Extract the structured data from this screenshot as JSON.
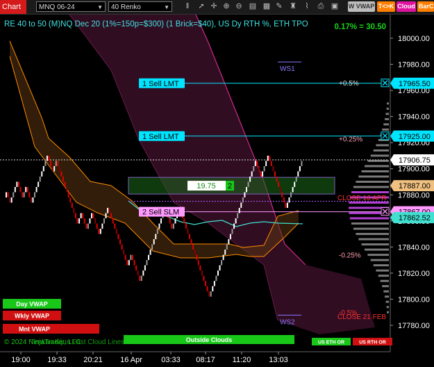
{
  "toolbar": {
    "chart_label": "Chart",
    "instrument": "MNQ 06-24",
    "bar_type": "40 Renko",
    "icons": [
      "bars-icon",
      "pointer-icon",
      "crosshair-icon",
      "zoom-in-icon",
      "zoom-out-icon",
      "properties-icon",
      "data-box-icon",
      "draw-icon",
      "strategy-icon",
      "indicators-icon",
      "templates-icon",
      "snapshot-icon"
    ],
    "buttons": [
      {
        "label": "W VWAP",
        "color": "#bdbdbd"
      },
      {
        "label": "T<>K",
        "color": "#ff7f00"
      },
      {
        "label": "Cloud",
        "color": "#e0119f"
      },
      {
        "label": "BarCo",
        "color": "#ff7f00"
      }
    ]
  },
  "chart_data": {
    "type": "candlestick",
    "title": "RE 40 to 50 (M)NQ Dec 20 (1%=150p=$300) (1 Brick=$40), US Dy RTH %, ETH TPO",
    "performance": "0.17% = 30.50",
    "ylim": [
      17772,
      18005
    ],
    "yticks": [
      18000,
      17980,
      17960,
      17940,
      17920,
      17900,
      17880,
      17860,
      17840,
      17820,
      17800,
      17780
    ],
    "xticks": [
      "19:00",
      "19:33",
      "20:21",
      "16 Apr",
      "03:33",
      "08:17",
      "11:20",
      "13:03"
    ],
    "bricks": [
      {
        "s": "u",
        "o": 17878,
        "c": 17882
      },
      {
        "s": "d",
        "o": 17882,
        "c": 17878
      },
      {
        "s": "d",
        "o": 17878,
        "c": 17874
      },
      {
        "s": "u",
        "o": 17874,
        "c": 17878
      },
      {
        "s": "u",
        "o": 17878,
        "c": 17882
      },
      {
        "s": "u",
        "o": 17882,
        "c": 17886
      },
      {
        "s": "u",
        "o": 17886,
        "c": 17890
      },
      {
        "s": "d",
        "o": 17890,
        "c": 17886
      },
      {
        "s": "d",
        "o": 17886,
        "c": 17882
      },
      {
        "s": "d",
        "o": 17882,
        "c": 17878
      },
      {
        "s": "u",
        "o": 17878,
        "c": 17882
      },
      {
        "s": "u",
        "o": 17882,
        "c": 17886
      },
      {
        "s": "d",
        "o": 17886,
        "c": 17882
      },
      {
        "s": "d",
        "o": 17882,
        "c": 17878
      },
      {
        "s": "d",
        "o": 17878,
        "c": 17874
      },
      {
        "s": "u",
        "o": 17874,
        "c": 17878
      },
      {
        "s": "u",
        "o": 17878,
        "c": 17882
      },
      {
        "s": "u",
        "o": 17882,
        "c": 17886
      },
      {
        "s": "u",
        "o": 17886,
        "c": 17890
      },
      {
        "s": "u",
        "o": 17890,
        "c": 17894
      },
      {
        "s": "u",
        "o": 17894,
        "c": 17898
      },
      {
        "s": "u",
        "o": 17898,
        "c": 17902
      },
      {
        "s": "u",
        "o": 17902,
        "c": 17906
      },
      {
        "s": "u",
        "o": 17906,
        "c": 17910
      },
      {
        "s": "d",
        "o": 17910,
        "c": 17906
      },
      {
        "s": "d",
        "o": 17906,
        "c": 17902
      },
      {
        "s": "d",
        "o": 17902,
        "c": 17898
      },
      {
        "s": "u",
        "o": 17898,
        "c": 17902
      },
      {
        "s": "u",
        "o": 17902,
        "c": 17906
      },
      {
        "s": "d",
        "o": 17906,
        "c": 17902
      },
      {
        "s": "d",
        "o": 17902,
        "c": 17898
      },
      {
        "s": "d",
        "o": 17898,
        "c": 17894
      },
      {
        "s": "d",
        "o": 17894,
        "c": 17890
      },
      {
        "s": "d",
        "o": 17890,
        "c": 17886
      },
      {
        "s": "d",
        "o": 17886,
        "c": 17882
      },
      {
        "s": "d",
        "o": 17882,
        "c": 17878
      },
      {
        "s": "d",
        "o": 17878,
        "c": 17874
      },
      {
        "s": "d",
        "o": 17874,
        "c": 17870
      },
      {
        "s": "d",
        "o": 17870,
        "c": 17866
      },
      {
        "s": "d",
        "o": 17866,
        "c": 17862
      },
      {
        "s": "d",
        "o": 17862,
        "c": 17858
      },
      {
        "s": "u",
        "o": 17858,
        "c": 17862
      },
      {
        "s": "u",
        "o": 17862,
        "c": 17866
      },
      {
        "s": "d",
        "o": 17866,
        "c": 17862
      },
      {
        "s": "d",
        "o": 17862,
        "c": 17858
      },
      {
        "s": "d",
        "o": 17858,
        "c": 17854
      },
      {
        "s": "u",
        "o": 17854,
        "c": 17858
      },
      {
        "s": "u",
        "o": 17858,
        "c": 17862
      },
      {
        "s": "u",
        "o": 17862,
        "c": 17866
      },
      {
        "s": "d",
        "o": 17866,
        "c": 17862
      },
      {
        "s": "d",
        "o": 17862,
        "c": 17858
      },
      {
        "s": "d",
        "o": 17858,
        "c": 17854
      },
      {
        "s": "d",
        "o": 17854,
        "c": 17850
      },
      {
        "s": "u",
        "o": 17850,
        "c": 17854
      },
      {
        "s": "u",
        "o": 17854,
        "c": 17858
      },
      {
        "s": "u",
        "o": 17858,
        "c": 17862
      },
      {
        "s": "u",
        "o": 17862,
        "c": 17866
      },
      {
        "s": "u",
        "o": 17866,
        "c": 17870
      },
      {
        "s": "d",
        "o": 17870,
        "c": 17866
      },
      {
        "s": "d",
        "o": 17866,
        "c": 17862
      },
      {
        "s": "d",
        "o": 17862,
        "c": 17858
      },
      {
        "s": "d",
        "o": 17858,
        "c": 17854
      },
      {
        "s": "d",
        "o": 17854,
        "c": 17850
      },
      {
        "s": "d",
        "o": 17850,
        "c": 17846
      },
      {
        "s": "d",
        "o": 17846,
        "c": 17842
      },
      {
        "s": "d",
        "o": 17842,
        "c": 17838
      },
      {
        "s": "d",
        "o": 17838,
        "c": 17834
      },
      {
        "s": "d",
        "o": 17834,
        "c": 17830
      },
      {
        "s": "d",
        "o": 17830,
        "c": 17826
      },
      {
        "s": "u",
        "o": 17826,
        "c": 17830
      },
      {
        "s": "u",
        "o": 17830,
        "c": 17834
      },
      {
        "s": "d",
        "o": 17834,
        "c": 17830
      },
      {
        "s": "d",
        "o": 17830,
        "c": 17826
      },
      {
        "s": "d",
        "o": 17826,
        "c": 17822
      },
      {
        "s": "d",
        "o": 17822,
        "c": 17818
      },
      {
        "s": "d",
        "o": 17818,
        "c": 17814
      },
      {
        "s": "u",
        "o": 17814,
        "c": 17818
      },
      {
        "s": "u",
        "o": 17818,
        "c": 17822
      },
      {
        "s": "u",
        "o": 17822,
        "c": 17826
      },
      {
        "s": "u",
        "o": 17826,
        "c": 17830
      },
      {
        "s": "u",
        "o": 17830,
        "c": 17834
      },
      {
        "s": "u",
        "o": 17834,
        "c": 17838
      },
      {
        "s": "u",
        "o": 17838,
        "c": 17842
      },
      {
        "s": "u",
        "o": 17842,
        "c": 17846
      },
      {
        "s": "u",
        "o": 17846,
        "c": 17850
      },
      {
        "s": "u",
        "o": 17850,
        "c": 17854
      },
      {
        "s": "u",
        "o": 17854,
        "c": 17858
      },
      {
        "s": "u",
        "o": 17858,
        "c": 17862
      },
      {
        "s": "u",
        "o": 17862,
        "c": 17866
      },
      {
        "s": "u",
        "o": 17866,
        "c": 17870
      },
      {
        "s": "d",
        "o": 17870,
        "c": 17866
      },
      {
        "s": "d",
        "o": 17866,
        "c": 17862
      },
      {
        "s": "d",
        "o": 17862,
        "c": 17858
      },
      {
        "s": "d",
        "o": 17858,
        "c": 17854
      },
      {
        "s": "u",
        "o": 17854,
        "c": 17858
      },
      {
        "s": "u",
        "o": 17858,
        "c": 17862
      },
      {
        "s": "u",
        "o": 17862,
        "c": 17866
      },
      {
        "s": "u",
        "o": 17866,
        "c": 17870
      },
      {
        "s": "d",
        "o": 17870,
        "c": 17866
      },
      {
        "s": "d",
        "o": 17866,
        "c": 17862
      },
      {
        "s": "d",
        "o": 17862,
        "c": 17858
      },
      {
        "s": "d",
        "o": 17858,
        "c": 17854
      },
      {
        "s": "d",
        "o": 17854,
        "c": 17850
      },
      {
        "s": "d",
        "o": 17850,
        "c": 17846
      },
      {
        "s": "d",
        "o": 17846,
        "c": 17842
      },
      {
        "s": "d",
        "o": 17842,
        "c": 17838
      },
      {
        "s": "d",
        "o": 17838,
        "c": 17834
      },
      {
        "s": "d",
        "o": 17834,
        "c": 17830
      },
      {
        "s": "d",
        "o": 17830,
        "c": 17826
      },
      {
        "s": "d",
        "o": 17826,
        "c": 17822
      },
      {
        "s": "d",
        "o": 17822,
        "c": 17818
      },
      {
        "s": "d",
        "o": 17818,
        "c": 17814
      },
      {
        "s": "d",
        "o": 17814,
        "c": 17810
      },
      {
        "s": "d",
        "o": 17810,
        "c": 17806
      },
      {
        "s": "d",
        "o": 17806,
        "c": 17802
      },
      {
        "s": "u",
        "o": 17802,
        "c": 17806
      },
      {
        "s": "u",
        "o": 17806,
        "c": 17810
      },
      {
        "s": "u",
        "o": 17810,
        "c": 17814
      },
      {
        "s": "u",
        "o": 17814,
        "c": 17818
      },
      {
        "s": "u",
        "o": 17818,
        "c": 17822
      },
      {
        "s": "u",
        "o": 17822,
        "c": 17826
      },
      {
        "s": "u",
        "o": 17826,
        "c": 17830
      },
      {
        "s": "u",
        "o": 17830,
        "c": 17834
      },
      {
        "s": "u",
        "o": 17834,
        "c": 17838
      },
      {
        "s": "u",
        "o": 17838,
        "c": 17842
      },
      {
        "s": "u",
        "o": 17842,
        "c": 17846
      },
      {
        "s": "u",
        "o": 17846,
        "c": 17850
      },
      {
        "s": "u",
        "o": 17850,
        "c": 17854
      },
      {
        "s": "u",
        "o": 17854,
        "c": 17858
      },
      {
        "s": "u",
        "o": 17858,
        "c": 17862
      },
      {
        "s": "u",
        "o": 17862,
        "c": 17866
      },
      {
        "s": "u",
        "o": 17866,
        "c": 17870
      },
      {
        "s": "u",
        "o": 17870,
        "c": 17874
      },
      {
        "s": "u",
        "o": 17874,
        "c": 17878
      },
      {
        "s": "u",
        "o": 17878,
        "c": 17882
      },
      {
        "s": "u",
        "o": 17882,
        "c": 17886
      },
      {
        "s": "u",
        "o": 17886,
        "c": 17890
      },
      {
        "s": "u",
        "o": 17890,
        "c": 17894
      },
      {
        "s": "u",
        "o": 17894,
        "c": 17898
      },
      {
        "s": "u",
        "o": 17898,
        "c": 17902
      },
      {
        "s": "u",
        "o": 17902,
        "c": 17906
      },
      {
        "s": "d",
        "o": 17906,
        "c": 17902
      },
      {
        "s": "d",
        "o": 17902,
        "c": 17898
      },
      {
        "s": "d",
        "o": 17898,
        "c": 17894
      },
      {
        "s": "u",
        "o": 17894,
        "c": 17898
      },
      {
        "s": "u",
        "o": 17898,
        "c": 17902
      },
      {
        "s": "u",
        "o": 17902,
        "c": 17906
      },
      {
        "s": "u",
        "o": 17906,
        "c": 17910
      },
      {
        "s": "d",
        "o": 17910,
        "c": 17906
      },
      {
        "s": "d",
        "o": 17906,
        "c": 17902
      },
      {
        "s": "d",
        "o": 17902,
        "c": 17898
      },
      {
        "s": "d",
        "o": 17898,
        "c": 17894
      },
      {
        "s": "d",
        "o": 17894,
        "c": 17890
      },
      {
        "s": "d",
        "o": 17890,
        "c": 17886
      },
      {
        "s": "d",
        "o": 17886,
        "c": 17882
      },
      {
        "s": "d",
        "o": 17882,
        "c": 17878
      },
      {
        "s": "d",
        "o": 17878,
        "c": 17874
      },
      {
        "s": "d",
        "o": 17874,
        "c": 17870
      },
      {
        "s": "u",
        "o": 17870,
        "c": 17874
      },
      {
        "s": "u",
        "o": 17874,
        "c": 17878
      },
      {
        "s": "u",
        "o": 17878,
        "c": 17882
      },
      {
        "s": "u",
        "o": 17882,
        "c": 17886
      },
      {
        "s": "u",
        "o": 17886,
        "c": 17890
      },
      {
        "s": "u",
        "o": 17890,
        "c": 17894
      },
      {
        "s": "u",
        "o": 17894,
        "c": 17898
      },
      {
        "s": "u",
        "o": 17898,
        "c": 17902
      },
      {
        "s": "u",
        "o": 17902,
        "c": 17906
      }
    ],
    "current_price": 17906.75,
    "price_labels": [
      {
        "value": 17965.5,
        "text": "17965.50",
        "bg": "#00e5ff",
        "fg": "#000"
      },
      {
        "value": 17925.0,
        "text": "17925.00",
        "bg": "#00e5ff",
        "fg": "#000"
      },
      {
        "value": 17906.75,
        "text": "17906.75",
        "bg": "#ffffff",
        "fg": "#000"
      },
      {
        "value": 17887.0,
        "text": "17887.00",
        "bg": "#f0c080",
        "fg": "#000"
      },
      {
        "value": 17867.0,
        "text": "17867.00",
        "bg": "#ff99ff",
        "fg": "#000"
      },
      {
        "value": 17862.52,
        "text": "17862.52",
        "bg": "#40e0d0",
        "fg": "#000"
      }
    ],
    "orders": [
      {
        "label": "1 Sell LMT",
        "value": 17965.5,
        "bg": "#00e5ff",
        "fg": "#000"
      },
      {
        "label": "1 Sell LMT",
        "value": 17925.0,
        "bg": "#00e5ff",
        "fg": "#000"
      },
      {
        "label": "2 Sell SLM",
        "value": 17867.0,
        "bg": "#ff99ff",
        "fg": "#000"
      }
    ],
    "position": {
      "pnl": "19.75",
      "qty": "2"
    },
    "annotations": [
      {
        "text": "WS1",
        "value": 17977,
        "color": "#8c78ff"
      },
      {
        "text": "WS2",
        "value": 17783,
        "color": "#8c78ff"
      },
      {
        "text": "+0.5%",
        "value": 17966,
        "color": "#dddddd"
      },
      {
        "text": "+0.25%",
        "value": 17923,
        "color": "#ff9fb0"
      },
      {
        "text": "CLOSE 16 APR",
        "value": 17878,
        "color": "#ff3030"
      },
      {
        "text": "-0.25%",
        "value": 17834,
        "color": "#ff9fb0"
      },
      {
        "text": "-0.5%",
        "value": 17790,
        "color": "#ff3030"
      },
      {
        "text": "CLOSE 21 FEB",
        "value": 17787,
        "color": "#ff3030"
      }
    ],
    "legend_buttons": [
      {
        "label": "Day VWAP",
        "color": "#19c719"
      },
      {
        "label": "Wkly VWAP",
        "color": "#d01010"
      },
      {
        "label": "Mnt VWAP",
        "color": "#d01010"
      }
    ],
    "bottom_buttons": [
      {
        "label": "Outside Clouds",
        "color": "#19c719"
      },
      {
        "label": "US ETH OR",
        "color": "#19c719"
      },
      {
        "label": "US RTH OR",
        "color": "#d01010"
      }
    ],
    "footer_text": "© 2024 NinjaTrader, LLC",
    "footer_overlay": "Tenkan Kijun Fast Cloud Lines",
    "colors": {
      "up": "#ffffff",
      "up_dim": "#9a9a9a",
      "down": "#e00000",
      "down_dim": "#8a0000",
      "cloud": "#3a0f28",
      "cloud_edge": "#d02a8a",
      "band": "#ff8c00",
      "vwap": "#40e0d0",
      "axis_text": "#ffffff",
      "bg": "#000000"
    }
  }
}
